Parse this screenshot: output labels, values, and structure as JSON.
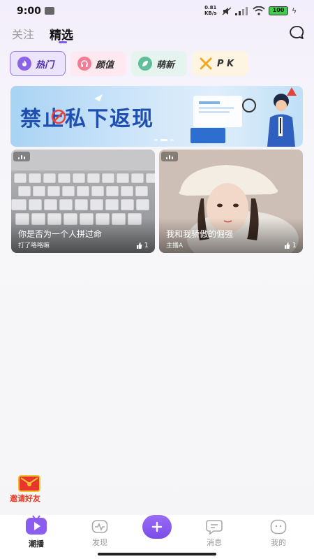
{
  "status_bar": {
    "time": "9:00",
    "net_speed": "0.81",
    "net_unit": "KB/s",
    "battery": "100"
  },
  "header": {
    "tabs": [
      {
        "label": "关注",
        "active": false
      },
      {
        "label": "精选",
        "active": true
      }
    ]
  },
  "categories": [
    {
      "label": "热门",
      "icon": "fire-icon",
      "active": true
    },
    {
      "label": "颜值",
      "icon": "headphones-icon",
      "active": false
    },
    {
      "label": "萌新",
      "icon": "leaf-icon",
      "active": false
    },
    {
      "label": "P K",
      "icon": "crossed-swords-icon",
      "active": false
    }
  ],
  "banner": {
    "title": "禁止私下返现"
  },
  "cards": [
    {
      "title": "你是否为一个人拼过命",
      "author": "打了咯咯嘛",
      "likes": "1"
    },
    {
      "title": "我和我骄傲的倔强",
      "author": "主播A",
      "likes": "1"
    }
  ],
  "invite": {
    "label": "邀请好友"
  },
  "bottom_nav": [
    {
      "label": "潮播",
      "icon": "play-tv-icon",
      "active": true
    },
    {
      "label": "发现",
      "icon": "pulse-icon",
      "active": false
    },
    {
      "label": "消息",
      "icon": "message-icon",
      "active": false
    },
    {
      "label": "我的",
      "icon": "profile-face-icon",
      "active": false
    }
  ],
  "colors": {
    "accent": "#7b5cf0",
    "banner_text": "#1f4fb0"
  }
}
